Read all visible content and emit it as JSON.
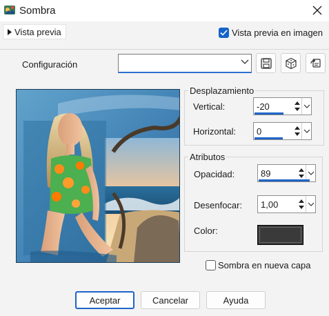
{
  "window": {
    "title": "Sombra",
    "icon": "paint-shop-pro-icon"
  },
  "preview_bar": {
    "toggle_label": "Vista previa",
    "preview_checkbox_label": "Vista previa en imagen",
    "preview_checked": true
  },
  "config": {
    "label": "Configuración",
    "value": "",
    "buttons": [
      "save-icon",
      "dice-icon",
      "reset-icon"
    ]
  },
  "offset_group": {
    "title": "Desplazamiento",
    "vertical_label": "Vertical:",
    "vertical_value": "-20",
    "horizontal_label": "Horizontal:",
    "horizontal_value": "0"
  },
  "attributes_group": {
    "title": "Atributos",
    "opacity_label": "Opacidad:",
    "opacity_value": "89",
    "opacity_fill_fraction": 0.89,
    "blur_label": "Desenfocar:",
    "blur_value": "1,00",
    "color_label": "Color:",
    "color_value": "#3a3a3a"
  },
  "new_layer": {
    "label": "Sombra en nueva capa",
    "checked": false
  },
  "buttons": {
    "ok": "Aceptar",
    "cancel": "Cancelar",
    "help": "Ayuda"
  },
  "colors": {
    "accent": "#1e64c8"
  }
}
